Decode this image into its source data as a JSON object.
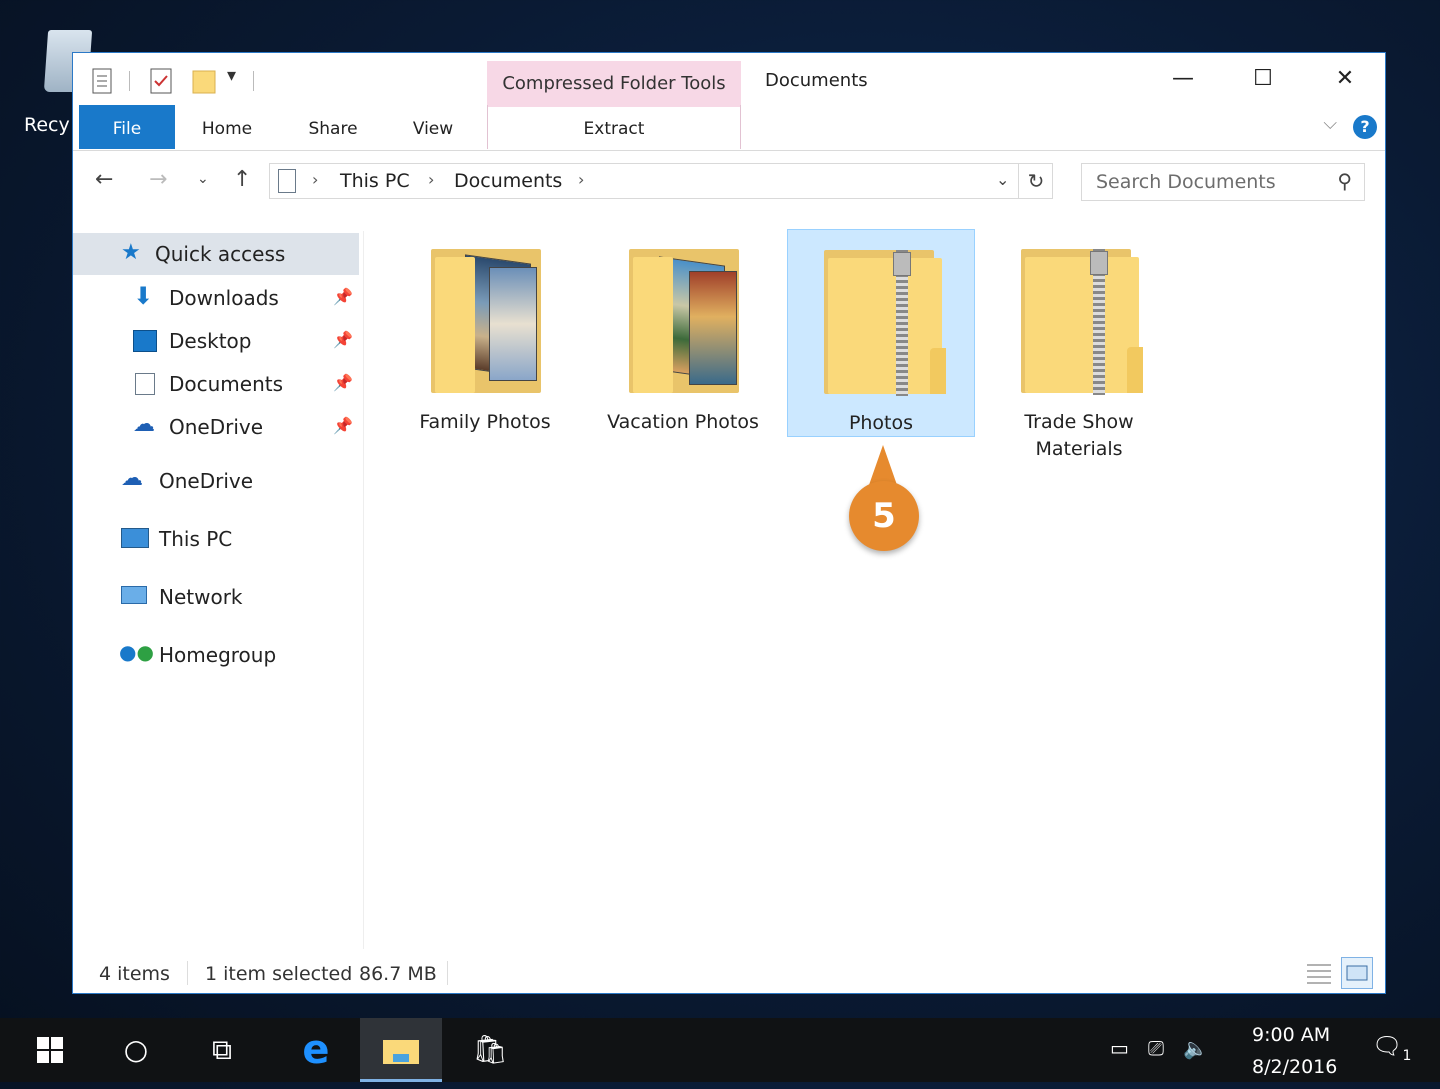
{
  "desktop": {
    "recycle_label": "Recy"
  },
  "window": {
    "title": "Documents",
    "context_group": "Compressed Folder Tools",
    "controls": {
      "minimize": "—",
      "maximize": "☐",
      "close": "✕"
    }
  },
  "ribbon": {
    "tabs": [
      "File",
      "Home",
      "Share",
      "View"
    ],
    "context_tab": "Extract",
    "help": "?"
  },
  "address": {
    "crumbs": [
      "This PC",
      "Documents"
    ],
    "search_placeholder": "Search Documents"
  },
  "nav": {
    "quick_access": "Quick access",
    "pinned": [
      {
        "label": "Downloads"
      },
      {
        "label": "Desktop"
      },
      {
        "label": "Documents"
      },
      {
        "label": "OneDrive"
      }
    ],
    "roots": [
      "OneDrive",
      "This PC",
      "Network",
      "Homegroup"
    ]
  },
  "files": [
    {
      "name": "Family Photos",
      "type": "folder",
      "selected": false
    },
    {
      "name": "Vacation Photos",
      "type": "folder",
      "selected": false
    },
    {
      "name": "Photos",
      "type": "zip",
      "selected": true
    },
    {
      "name": "Trade Show Materials",
      "type": "zip",
      "selected": false
    }
  ],
  "callout": "5",
  "status": {
    "count": "4 items",
    "selection": "1 item selected",
    "size": "86.7 MB"
  },
  "taskbar": {
    "time": "9:00 AM",
    "date": "8/2/2016",
    "notification_count": "1"
  },
  "colors": {
    "accent": "#1979ca",
    "selection": "#cce8ff",
    "callout": "#e68a2e",
    "context_tab": "#f7d8e6"
  }
}
